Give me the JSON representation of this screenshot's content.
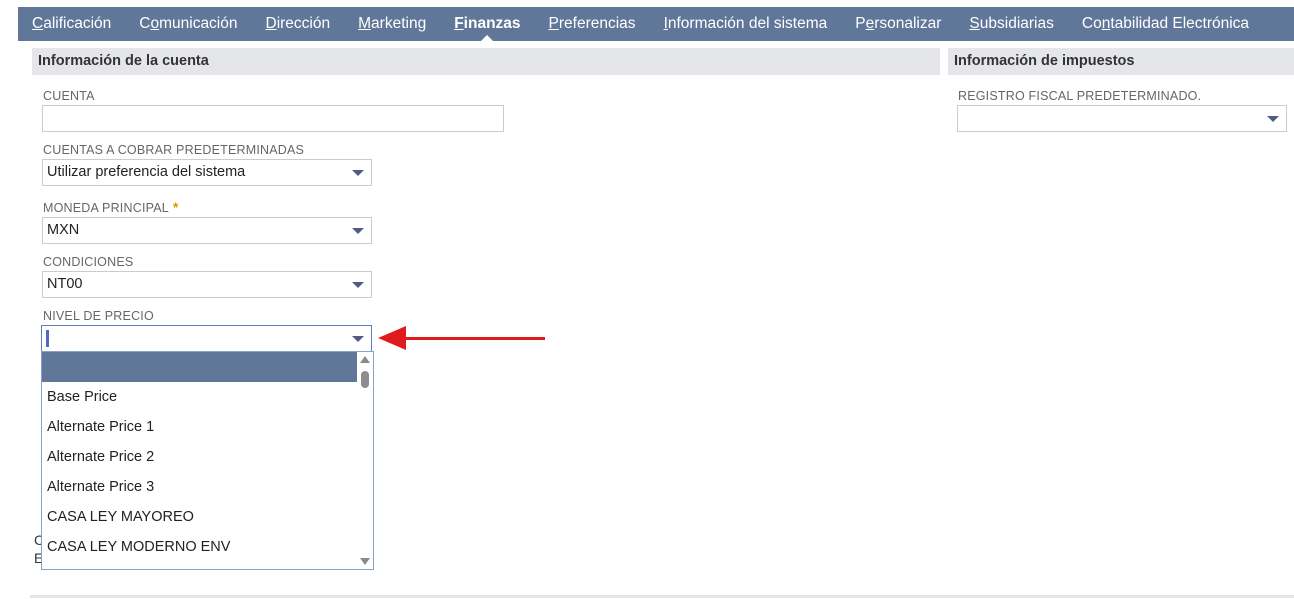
{
  "tabs": [
    {
      "pre": "",
      "ul": "C",
      "post": "alificación"
    },
    {
      "pre": "C",
      "ul": "o",
      "post": "municación"
    },
    {
      "pre": "",
      "ul": "D",
      "post": "irección"
    },
    {
      "pre": "",
      "ul": "M",
      "post": "arketing"
    },
    {
      "pre": "",
      "ul": "F",
      "post": "inanzas"
    },
    {
      "pre": "",
      "ul": "P",
      "post": "referencias"
    },
    {
      "pre": "",
      "ul": "I",
      "post": "nformación del sistema"
    },
    {
      "pre": "P",
      "ul": "e",
      "post": "rsonalizar"
    },
    {
      "pre": "",
      "ul": "S",
      "post": "ubsidiarias"
    },
    {
      "pre": "Co",
      "ul": "n",
      "post": "tabilidad Electrónica"
    }
  ],
  "sections": {
    "account_info": "Información de la cuenta",
    "tax_info": "Información de impuestos"
  },
  "fields": {
    "cuenta": {
      "label": "CUENTA",
      "value": ""
    },
    "cuentas_cobrar": {
      "label": "CUENTAS A COBRAR PREDETERMINADAS",
      "value": "Utilizar preferencia del sistema"
    },
    "moneda": {
      "label": "MONEDA PRINCIPAL",
      "required_mark": "*",
      "value": "MXN"
    },
    "condiciones": {
      "label": "CONDICIONES",
      "value": "NT00"
    },
    "nivel_precio": {
      "label": "NIVEL DE PRECIO",
      "value": ""
    },
    "registro_fiscal": {
      "label": "REGISTRO FISCAL PREDETERMINADO.",
      "value": ""
    }
  },
  "dropdown_options": [
    "",
    "Base Price",
    "Alternate Price 1",
    "Alternate Price 2",
    "Alternate Price 3",
    "CASA LEY MAYOREO",
    "CASA LEY MODERNO ENV"
  ],
  "obscured_text": {
    "line1": "C",
    "line2": "E"
  },
  "icons": {
    "dropdown": "caret-down-icon",
    "annotation": "red-arrow-icon"
  },
  "colors": {
    "tabbar": "#607799",
    "selected_option": "#607799",
    "arrow": "#e01b1b",
    "required": "#e09a00"
  }
}
